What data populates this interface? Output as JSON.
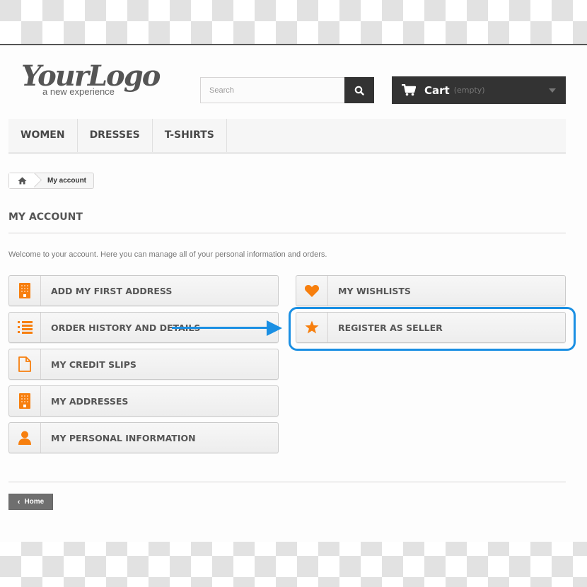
{
  "header": {
    "logo_script": "YourLogo",
    "logo_tagline": "a new experience",
    "search": {
      "placeholder": "Search",
      "value": ""
    },
    "cart": {
      "label": "Cart",
      "status": "(empty)"
    }
  },
  "menu": {
    "items": [
      {
        "label": "WOMEN"
      },
      {
        "label": "DRESSES"
      },
      {
        "label": "T-SHIRTS"
      }
    ]
  },
  "breadcrumb": {
    "home_icon": "home-icon",
    "current": "My account"
  },
  "page": {
    "title": "MY ACCOUNT",
    "info": "Welcome to your account. Here you can manage all of your personal information and orders."
  },
  "account_links": {
    "left": [
      {
        "label": "ADD MY FIRST ADDRESS",
        "icon": "building-icon"
      },
      {
        "label": "ORDER HISTORY AND DETAILS",
        "icon": "ordered-list-icon"
      },
      {
        "label": "MY CREDIT SLIPS",
        "icon": "file-icon"
      },
      {
        "label": "MY ADDRESSES",
        "icon": "building-icon"
      },
      {
        "label": "MY PERSONAL INFORMATION",
        "icon": "user-icon"
      }
    ],
    "right": [
      {
        "label": "MY WISHLISTS",
        "icon": "heart-icon"
      },
      {
        "label": "REGISTER AS SELLER",
        "icon": "star-icon"
      }
    ]
  },
  "footer": {
    "home_button": "Home"
  },
  "colors": {
    "accent_orange": "#f77f0e",
    "annotation_blue": "#1a8fe3",
    "dark": "#333333"
  }
}
